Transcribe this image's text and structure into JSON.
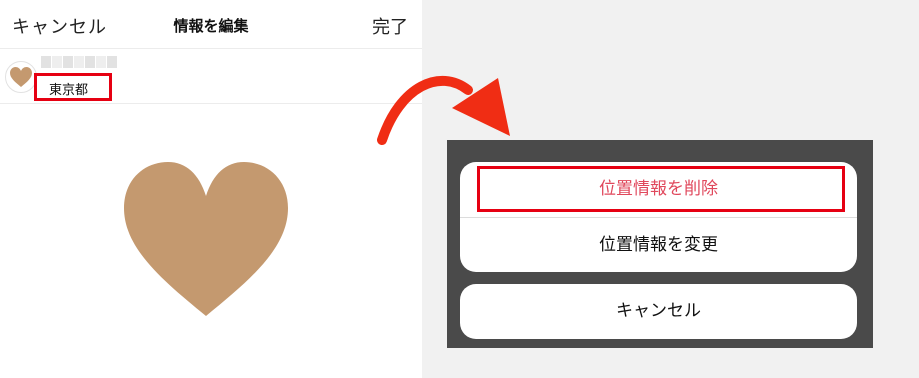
{
  "navbar": {
    "cancel_label": "キャンセル",
    "title": "情報を編集",
    "done_label": "完了"
  },
  "post": {
    "location": "東京都",
    "avatar_icon": "heart-icon"
  },
  "colors": {
    "heart": "#c4996f",
    "highlight": "#e60012",
    "arrow": "#f02d14",
    "delete_text": "#e0485c",
    "sheet_overlay": "#4a4a4a"
  },
  "action_sheet": {
    "delete_label": "位置情報を削除",
    "change_label": "位置情報を変更",
    "cancel_label": "キャンセル"
  }
}
